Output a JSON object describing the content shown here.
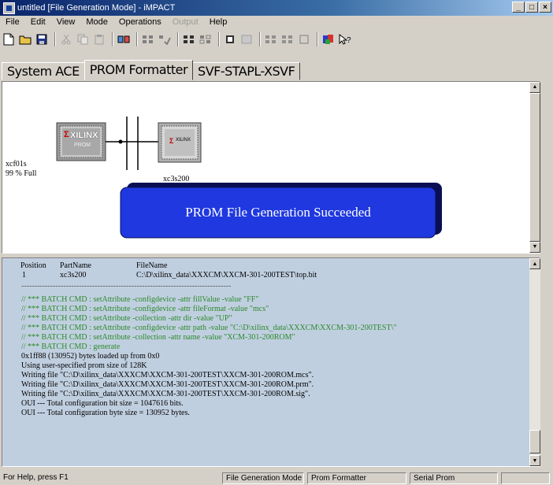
{
  "window": {
    "title": "untitled [File Generation Mode] - iMPACT"
  },
  "menubar": {
    "items": [
      "File",
      "Edit",
      "View",
      "Mode",
      "Operations",
      "Output",
      "Help"
    ]
  },
  "tabs": [
    "System ACE",
    "PROM Formatter",
    "SVF-STAPL-XSVF"
  ],
  "diagram": {
    "prom_brand": "XILINX",
    "prom_sub": "PROM",
    "prom_name": "xcf01s",
    "prom_fill": "99 % Full",
    "device_brand": "XILINX",
    "device_name": "xc3s200",
    "success_message": "PROM File Generation Succeeded"
  },
  "log": {
    "headers": [
      "Position",
      "PartName",
      "FileName"
    ],
    "row": [
      "1",
      "xc3s200",
      "C:\\D\\xilinx_data\\XXXCM\\XXCM-301-200TEST\\top.bit"
    ],
    "separator": "--------------------------------------------------------------------------------",
    "batch_lines": [
      "// *** BATCH CMD : setAttribute -configdevice -attr fillValue -value \"FF\"",
      "// *** BATCH CMD : setAttribute -configdevice -attr fileFormat -value \"mcs\"",
      "// *** BATCH CMD : setAttribute -collection -attr dir -value \"UP\"",
      "// *** BATCH CMD : setAttribute -configdevice -attr path -value \"C:\\D\\xilinx_data\\XXXCM\\XXCM-301-200TEST\\\"",
      "// *** BATCH CMD : setAttribute -collection -attr name -value \"XCM-301-200ROM\"",
      "// *** BATCH CMD : generate"
    ],
    "output_lines": [
      "0x1ff88 (130952) bytes loaded up from 0x0",
      "Using user-specified prom size of 128K",
      "Writing file \"C:\\D\\xilinx_data\\XXXCM\\XXCM-301-200TEST\\XXCM-301-200ROM.mcs\".",
      "Writing file \"C:\\D\\xilinx_data\\XXXCM\\XXCM-301-200TEST\\XXCM-301-200ROM.prm\".",
      "Writing file \"C:\\D\\xilinx_data\\XXXCM\\XXCM-301-200TEST\\XXCM-301-200ROM.sig\".",
      "OUI --- Total configuration bit size = 1047616 bits.",
      "OUI --- Total configuration byte size = 130952 bytes."
    ]
  },
  "statusbar": {
    "help": "For Help, press F1",
    "mode": "File Generation Mode",
    "tab": "Prom Formatter",
    "target": "Serial Prom"
  },
  "colors": {
    "success_fill": "#1f38e0",
    "success_shadow": "#0a0f55",
    "log_bg": "#c0cfe0",
    "batch_text": "#2a8a2a"
  }
}
